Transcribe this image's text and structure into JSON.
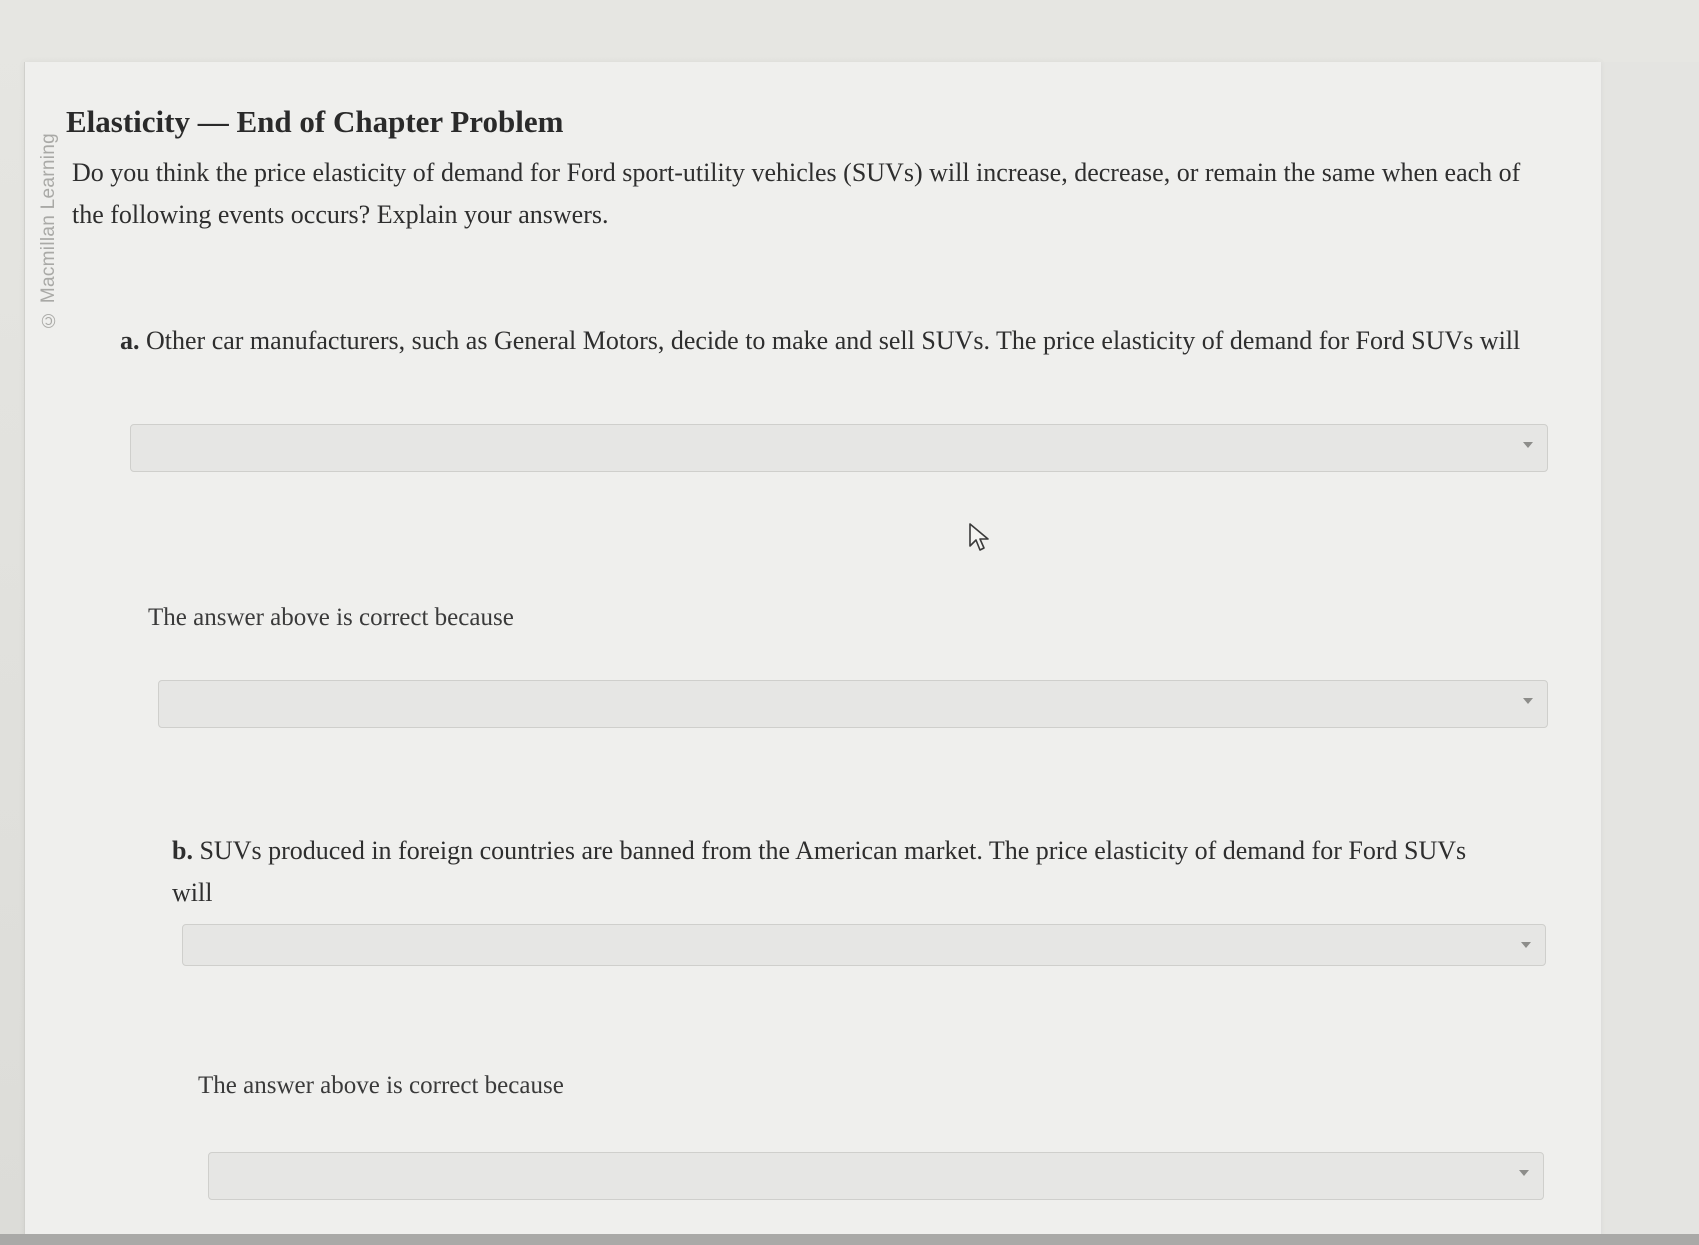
{
  "watermark": "© Macmillan Learning",
  "title": "Elasticity — End of Chapter Problem",
  "intro": "Do you think the price elasticity of demand for Ford sport-utility vehicles (SUVs) will increase, decrease, or remain the same when each of the following events occurs? Explain your answers.",
  "questions": [
    {
      "letter": "a.",
      "text": " Other car manufacturers, such as General Motors, decide to make and sell SUVs. The price elasticity of demand for Ford SUVs will",
      "answer_value": "",
      "because_label": "The answer above is correct because",
      "because_value": ""
    },
    {
      "letter": "b.",
      "text": " SUVs produced in foreign countries are banned from the American market. The price elasticity of demand for Ford SUVs will",
      "answer_value": "",
      "because_label": "The answer above is correct because",
      "because_value": ""
    }
  ],
  "icons": {
    "dropdown_caret": "chevron-down-icon",
    "cursor": "mouse-pointer-icon"
  }
}
